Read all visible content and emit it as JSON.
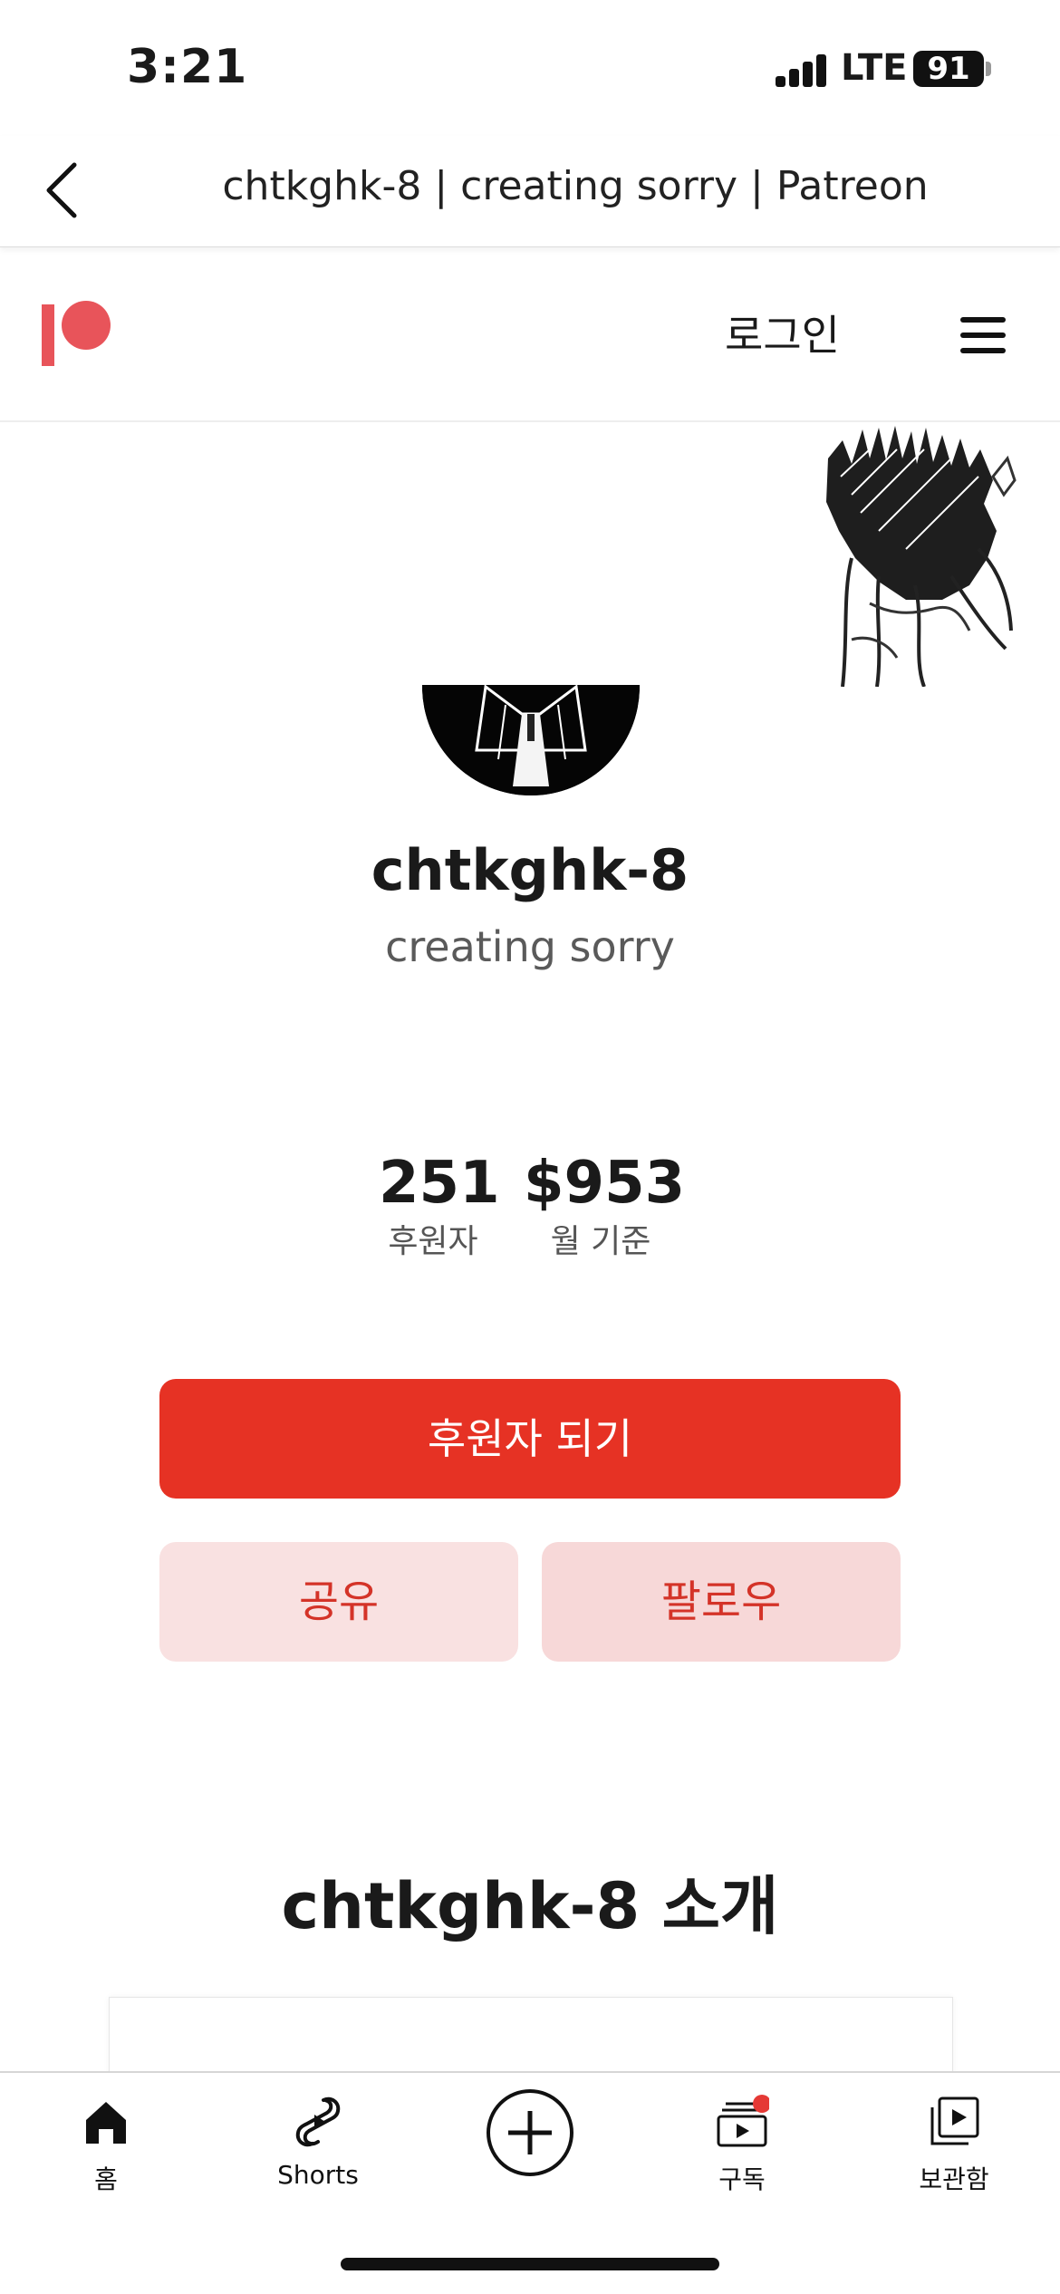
{
  "status_bar": {
    "time": "3:21",
    "network": "LTE",
    "battery": "91"
  },
  "browser": {
    "title": "chtkghk-8 | creating sorry | Patreon"
  },
  "header": {
    "login_label": "로그인",
    "brand_color": "#e8545a"
  },
  "creator": {
    "name": "chtkghk-8",
    "tagline": "creating sorry"
  },
  "stats": {
    "patrons_value": "251",
    "patrons_label": "후원자",
    "income_value": "$953",
    "income_label": "월 기준"
  },
  "actions": {
    "become_patron_label": "후원자 되기",
    "share_label": "공유",
    "follow_label": "팔로우",
    "primary_color": "#e63224"
  },
  "about": {
    "title": "chtkghk-8 소개"
  },
  "tab_bar": {
    "tabs": [
      {
        "label": "홈",
        "icon": "home-icon"
      },
      {
        "label": "Shorts",
        "icon": "shorts-icon"
      },
      {
        "label": "",
        "icon": "create-plus-icon"
      },
      {
        "label": "구독",
        "icon": "subscriptions-icon"
      },
      {
        "label": "보관함",
        "icon": "library-icon"
      }
    ],
    "notification_color": "#e53935"
  }
}
